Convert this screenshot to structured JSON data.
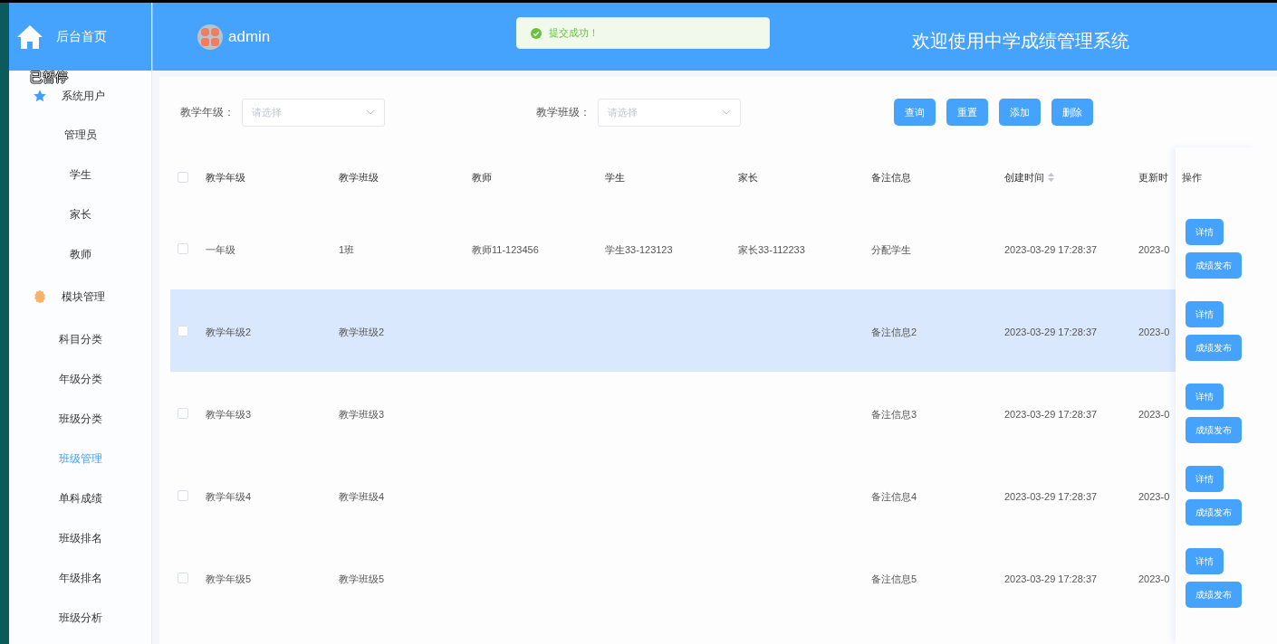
{
  "sidebar": {
    "home": {
      "label": "后台首页"
    },
    "groups": [
      {
        "label": "系统用户",
        "kind": "star",
        "items": [
          {
            "label": "管理员",
            "selected": false
          },
          {
            "label": "学生",
            "selected": false
          },
          {
            "label": "家长",
            "selected": false
          },
          {
            "label": "教师",
            "selected": false
          }
        ]
      },
      {
        "label": "模块管理",
        "kind": "gear",
        "items": [
          {
            "label": "科目分类",
            "selected": false
          },
          {
            "label": "年级分类",
            "selected": false
          },
          {
            "label": "班级分类",
            "selected": false
          },
          {
            "label": "班级管理",
            "selected": true
          },
          {
            "label": "单科成绩",
            "selected": false
          },
          {
            "label": "班级排名",
            "selected": false
          },
          {
            "label": "年级排名",
            "selected": false
          },
          {
            "label": "班级分析",
            "selected": false
          }
        ]
      }
    ]
  },
  "pause_overlay": "已暂停",
  "header": {
    "user": "admin",
    "toast": {
      "message": "提交成功！"
    },
    "title": "欢迎使用中学成绩管理系统"
  },
  "filters": [
    {
      "label": "教学年级：",
      "placeholder": "请选择"
    },
    {
      "label": "教学班级：",
      "placeholder": "请选择"
    }
  ],
  "actions": [
    "查询",
    "重置",
    "添加",
    "删除"
  ],
  "table": {
    "header_checked": false,
    "columns": [
      {
        "label": "教学年级",
        "sortable": false
      },
      {
        "label": "教学班级",
        "sortable": false
      },
      {
        "label": "教师",
        "sortable": false
      },
      {
        "label": "学生",
        "sortable": false
      },
      {
        "label": "家长",
        "sortable": false
      },
      {
        "label": "备注信息",
        "sortable": false
      },
      {
        "label": "创建时间",
        "sortable": true
      },
      {
        "label": "更新时",
        "sortable": false
      }
    ],
    "ops_column": "操作",
    "rows": [
      {
        "checked": false,
        "highlighted": false,
        "cells": [
          "一年级",
          "1班",
          "教师11-123456",
          "学生33-123123",
          "家长33-112233",
          "分配学生",
          "2023-03-29 17:28:37",
          "2023-0"
        ],
        "actions": [
          "详情",
          "成绩发布"
        ]
      },
      {
        "checked": false,
        "highlighted": true,
        "cells": [
          "教学年级2",
          "教学班级2",
          null,
          null,
          null,
          "备注信息2",
          "2023-03-29 17:28:37",
          "2023-0"
        ],
        "actions": [
          "详情",
          "成绩发布"
        ]
      },
      {
        "checked": false,
        "highlighted": false,
        "cells": [
          "教学年级3",
          "教学班级3",
          null,
          null,
          null,
          "备注信息3",
          "2023-03-29 17:28:37",
          "2023-0"
        ],
        "actions": [
          "详情",
          "成绩发布"
        ]
      },
      {
        "checked": false,
        "highlighted": false,
        "cells": [
          "教学年级4",
          "教学班级4",
          null,
          null,
          null,
          "备注信息4",
          "2023-03-29 17:28:37",
          "2023-0"
        ],
        "actions": [
          "详情",
          "成绩发布"
        ]
      },
      {
        "checked": false,
        "highlighted": false,
        "cells": [
          "教学年级5",
          "教学班级5",
          null,
          null,
          null,
          "备注信息5",
          "2023-03-29 17:28:37",
          "2023-0"
        ],
        "actions": [
          "详情",
          "成绩发布"
        ]
      }
    ]
  }
}
